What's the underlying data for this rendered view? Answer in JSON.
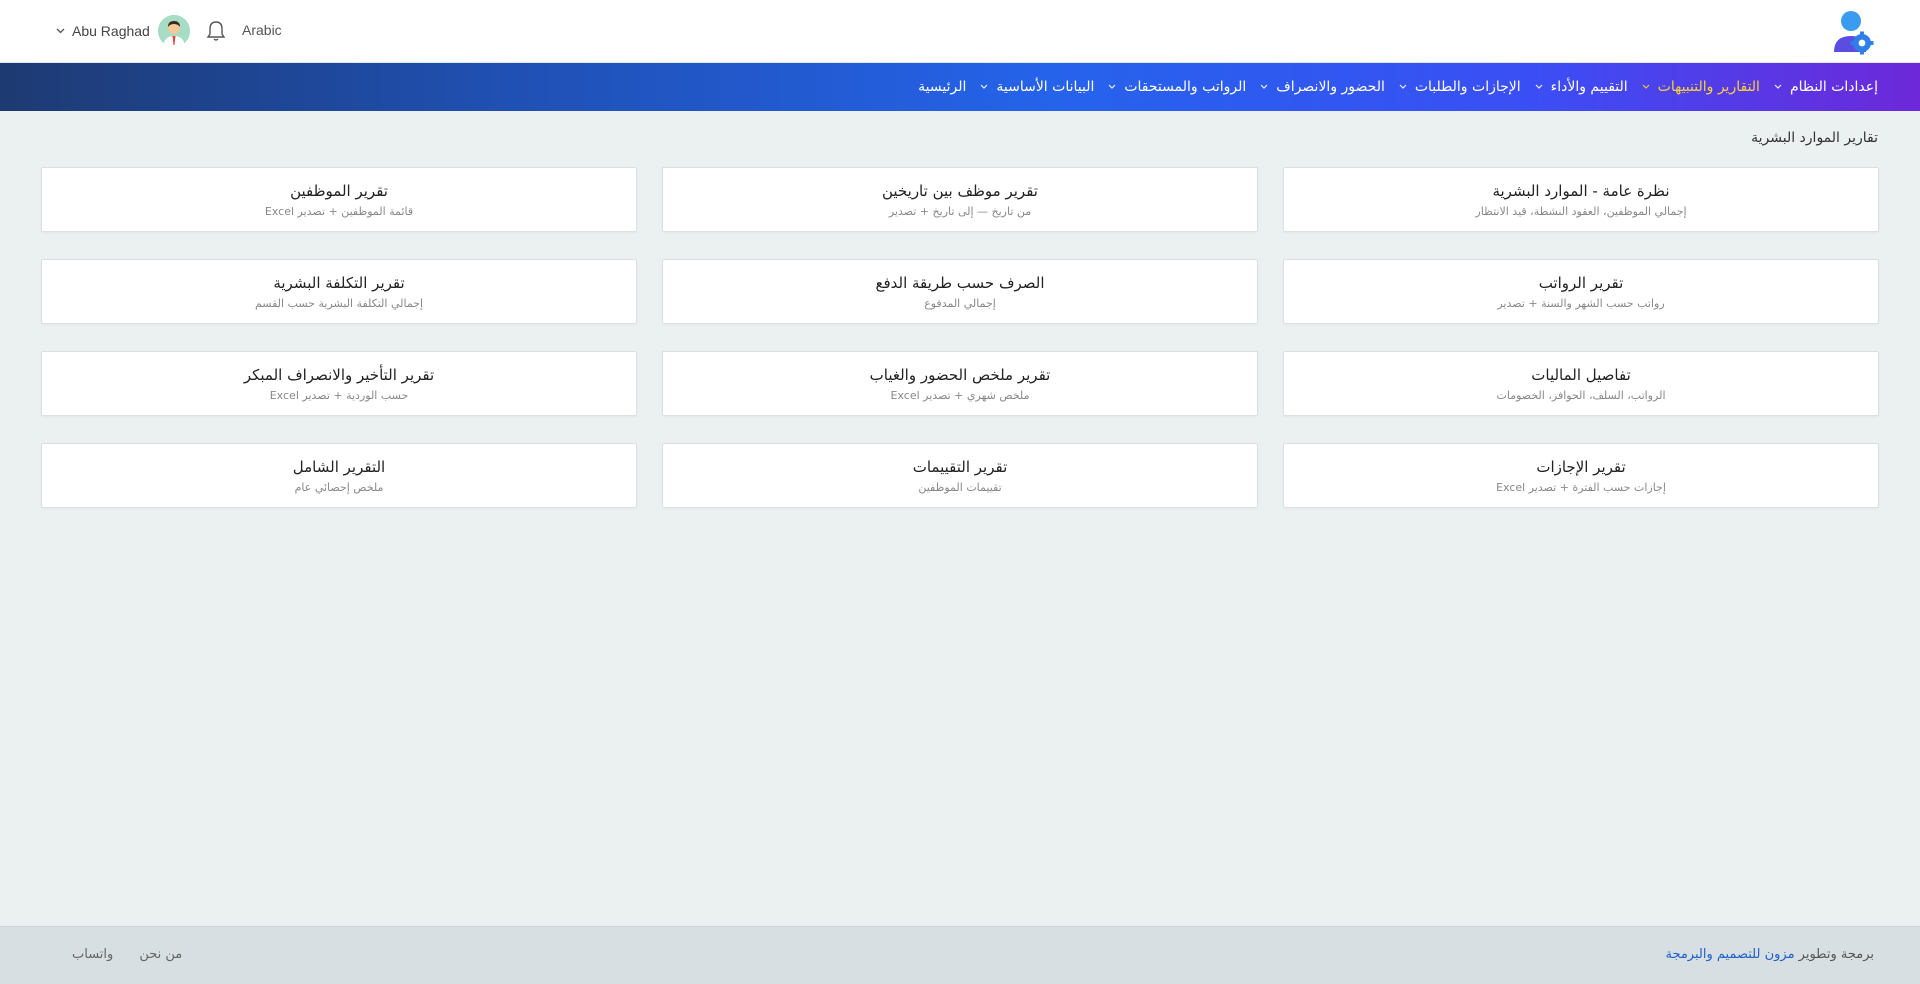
{
  "header": {
    "user_name": "Abu Raghad",
    "language": "Arabic"
  },
  "nav": {
    "items": [
      {
        "label": "الرئيسية",
        "active": false,
        "dropdown": false
      },
      {
        "label": "البيانات الأساسية",
        "active": false,
        "dropdown": true
      },
      {
        "label": "الرواتب والمستحقات",
        "active": false,
        "dropdown": true
      },
      {
        "label": "الحضور والانصراف",
        "active": false,
        "dropdown": true
      },
      {
        "label": "الإجازات والطلبات",
        "active": false,
        "dropdown": true
      },
      {
        "label": "التقييم والأداء",
        "active": false,
        "dropdown": true
      },
      {
        "label": "التقارير والتنبيهات",
        "active": true,
        "dropdown": true
      },
      {
        "label": "إعدادات النظام",
        "active": false,
        "dropdown": true
      }
    ]
  },
  "page": {
    "title": "تقارير الموارد البشرية"
  },
  "cards": [
    {
      "title": "نظرة عامة - الموارد البشرية",
      "subtitle": "إجمالي الموظفين، العقود النشطة، قيد الانتظار"
    },
    {
      "title": "تقرير موظف بين تاريخين",
      "subtitle": "من تاريخ — إلى تاريخ + تصدير"
    },
    {
      "title": "تقرير الموظفين",
      "subtitle": "قائمة الموظفين + تصدير Excel"
    },
    {
      "title": "تقرير الرواتب",
      "subtitle": "رواتب حسب الشهر والسنة + تصدير"
    },
    {
      "title": "الصرف حسب طريقة الدفع",
      "subtitle": "إجمالي المدفوع"
    },
    {
      "title": "تقرير التكلفة البشرية",
      "subtitle": "إجمالي التكلفة البشرية حسب القسم"
    },
    {
      "title": "تفاصيل الماليات",
      "subtitle": "الرواتب، السلف، الحوافز، الخصومات"
    },
    {
      "title": "تقرير ملخص الحضور والغياب",
      "subtitle": "ملخص شهري + تصدير Excel"
    },
    {
      "title": "تقرير التأخير والانصراف المبكر",
      "subtitle": "حسب الوردية + تصدير Excel"
    },
    {
      "title": "تقرير الإجازات",
      "subtitle": "إجازات حسب الفترة + تصدير Excel"
    },
    {
      "title": "تقرير التقييمات",
      "subtitle": "تقييمات الموظفين"
    },
    {
      "title": "التقرير الشامل",
      "subtitle": "ملخص إحصائي عام"
    }
  ],
  "footer": {
    "credit_prefix": "برمجة وتطوير ",
    "credit_brand": "مزون للتصميم والبرمجة",
    "links": [
      "من نحن",
      "واتساب"
    ]
  },
  "colors": {
    "nav_active": "#fbd13b",
    "brand_link": "#1d5fc9"
  }
}
